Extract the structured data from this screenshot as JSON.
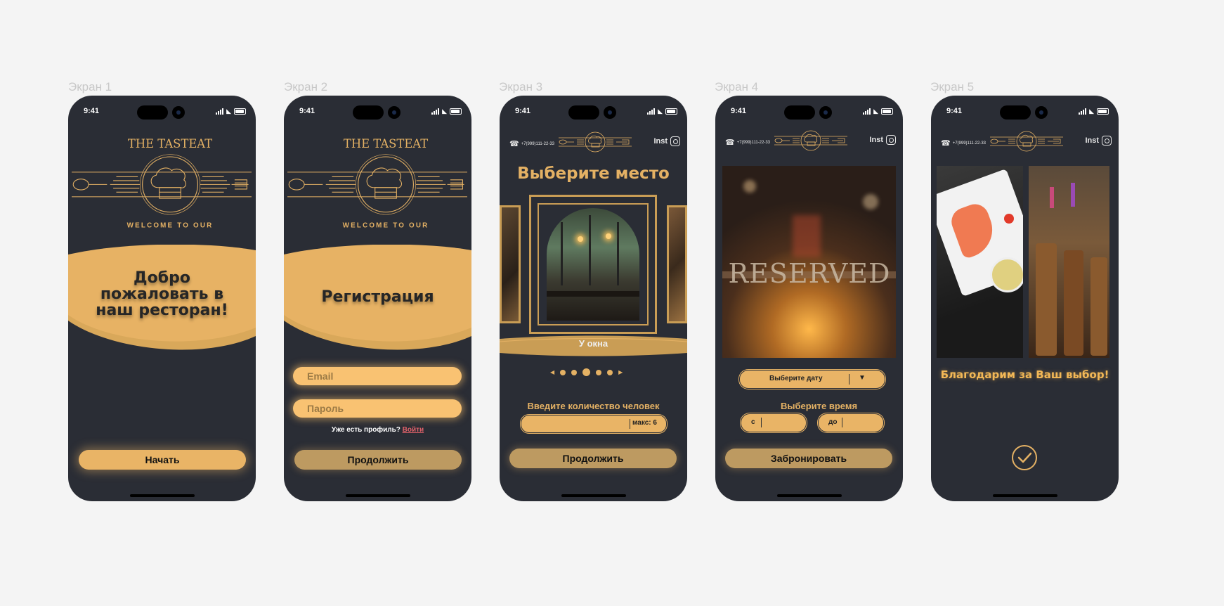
{
  "status_time": "9:41",
  "labels": [
    "Экран 1",
    "Экран 2",
    "Экран 3",
    "Экран 4",
    "Экран 5"
  ],
  "brand": {
    "top": "THE TASTEAT",
    "bottom": "WELCOME TO OUR"
  },
  "header": {
    "phone": "+7(999)111-22-33",
    "inst": "Inst"
  },
  "screen1": {
    "title_l1": "Добро",
    "title_l2": "пожаловать в",
    "title_l3": "наш ресторан!",
    "start_button": "Начать"
  },
  "screen2": {
    "title": "Регистрация",
    "email_placeholder": "Email",
    "password_placeholder": "Пароль",
    "have_profile": "Уже есть профиль?",
    "login_link": "Войти",
    "continue_button": "Продолжить"
  },
  "screen3": {
    "title": "Выберите место",
    "place_caption": "У окна",
    "people_label": "Введите количество человек",
    "people_max": "макс: 6",
    "continue_button": "Продолжить"
  },
  "screen4": {
    "date_select": "Выберите дату",
    "time_label": "Выберите время",
    "from_label": "с",
    "to_label": "до",
    "book_button": "Забронировать"
  },
  "screen5": {
    "thanks": "Благодарим за Ваш выбор!"
  },
  "colors": {
    "background": "#f4f4f4",
    "phone": "#2a2d35",
    "accent": "#e4b164"
  }
}
